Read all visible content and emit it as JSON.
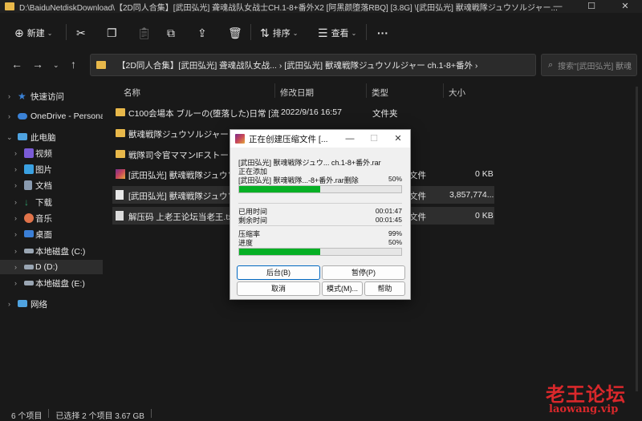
{
  "window": {
    "title": "D:\\BaiduNetdiskDownload\\【2D同人合集】[武田弘光] 聋魂战队女战士CH.1-8+番外X2 [阿黑颜堕落RBQ] [3.8G] \\[武田弘光] 獸魂戦隊ジュウソルジャー...",
    "minimize": "—",
    "maximize": "☐",
    "close": "✕"
  },
  "toolbar": {
    "new_label": "新建",
    "sort_label": "排序",
    "view_label": "查看",
    "more": "···"
  },
  "address": {
    "path": "【2D同人合集】[武田弘光] 聋魂战队女战...  ›  [武田弘光] 獸魂戦隊ジュウソルジャー ch.1-8+番外  ›",
    "search_placeholder": "搜索\"[武田弘光] 獸魂"
  },
  "sidebar": {
    "items": [
      {
        "label": "快速访问",
        "color": "#3b82d6"
      },
      {
        "label": "OneDrive - Persona",
        "color": "#3b82d6"
      },
      {
        "label": "此电脑",
        "color": "#4fa3e0"
      },
      {
        "label": "视频",
        "color": "#7a5bd6"
      },
      {
        "label": "图片",
        "color": "#3aa0e0"
      },
      {
        "label": "文档",
        "color": "#8a9bb0"
      },
      {
        "label": "下载",
        "color": "#2e9e6b"
      },
      {
        "label": "音乐",
        "color": "#e0734a"
      },
      {
        "label": "桌面",
        "color": "#3b7fd6"
      },
      {
        "label": "本地磁盘 (C:)",
        "color": "#9aa6b3"
      },
      {
        "label": "D (D:)",
        "color": "#9aa6b3"
      },
      {
        "label": "本地磁盘 (E:)",
        "color": "#9aa6b3"
      },
      {
        "label": "网络",
        "color": "#4fa3e0"
      }
    ]
  },
  "columns": {
    "name": "名称",
    "modified": "修改日期",
    "type": "类型",
    "size": "大小"
  },
  "files": [
    {
      "name": "C100会場本 ブルーの(堕落した)日常 [流...",
      "modified": "2022/9/16 16:57",
      "type": "文件夹",
      "size": "",
      "icon": "folder"
    },
    {
      "name": "獸魂戦隊ジュウソルジャー ch",
      "modified": "",
      "type": "",
      "size": "",
      "icon": "folder"
    },
    {
      "name": "戦隊司令官ママンIFストーリー",
      "modified": "",
      "type": "",
      "size": "",
      "icon": "folder"
    },
    {
      "name": "[武田弘光] 獸魂戦隊ジュウソル",
      "modified": "",
      "type": "文件",
      "size": "0 KB",
      "icon": "rar"
    },
    {
      "name": "[武田弘光] 獸魂戦隊ジュウソル",
      "modified": "",
      "type": "文件",
      "size": "3,857,774...",
      "icon": "file"
    },
    {
      "name": "解压码 上老王论坛当老王.txt",
      "modified": "",
      "type": "文件",
      "size": "0 KB",
      "icon": "txt"
    }
  ],
  "status": {
    "count": "6 个项目",
    "selection": "已选择 2 个项目  3.67 GB"
  },
  "dialog": {
    "title": "正在创建压缩文件 [...",
    "archive_line": "[武田弘光] 獸魂戦隊ジュウ... ch.1-8+番外.rar",
    "action": "正在添加",
    "current_file": "[武田弘光] 獸魂戦隊...-8+番外.rar删除",
    "file_percent": "50%",
    "file_progress": 0.5,
    "elapsed_label": "已用时间",
    "elapsed_value": "00:01:47",
    "remaining_label": "剩余时间",
    "remaining_value": "00:01:45",
    "ratio_label": "压缩率",
    "ratio_value": "99%",
    "progress_label": "进度",
    "progress_value": "50%",
    "total_progress": 0.5,
    "background_button": "后台(B)",
    "pause_button": "暂停(P)",
    "cancel_button": "取消",
    "mode_button": "模式(M)...",
    "help_button": "帮助"
  },
  "watermark": {
    "line1": "老王论坛",
    "line2": "laowang.vip"
  }
}
